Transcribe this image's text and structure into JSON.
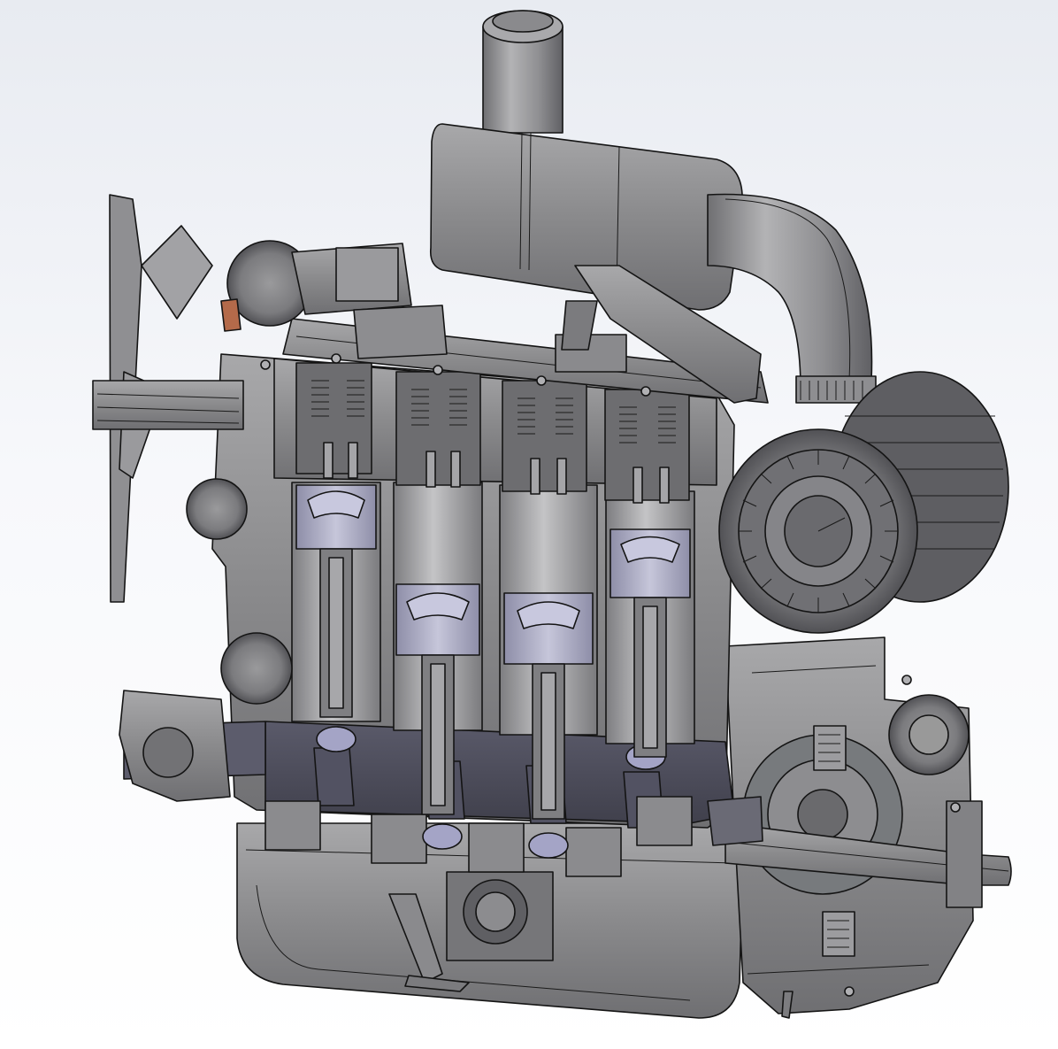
{
  "scene": {
    "subject": "engine-cutaway-model",
    "colors": {
      "background_top": "#e8ebf1",
      "background_bottom": "#ffffff",
      "metal_light": "#b7b7b9",
      "metal_mid": "#8e8e90",
      "metal_dark": "#5f5f63",
      "crankshaft": "#4b4b5a",
      "piston": "#a3a3bd",
      "accent_copper": "#b46a4a",
      "outline": "#141414"
    },
    "components": {
      "cylinder_count": 4
    }
  }
}
